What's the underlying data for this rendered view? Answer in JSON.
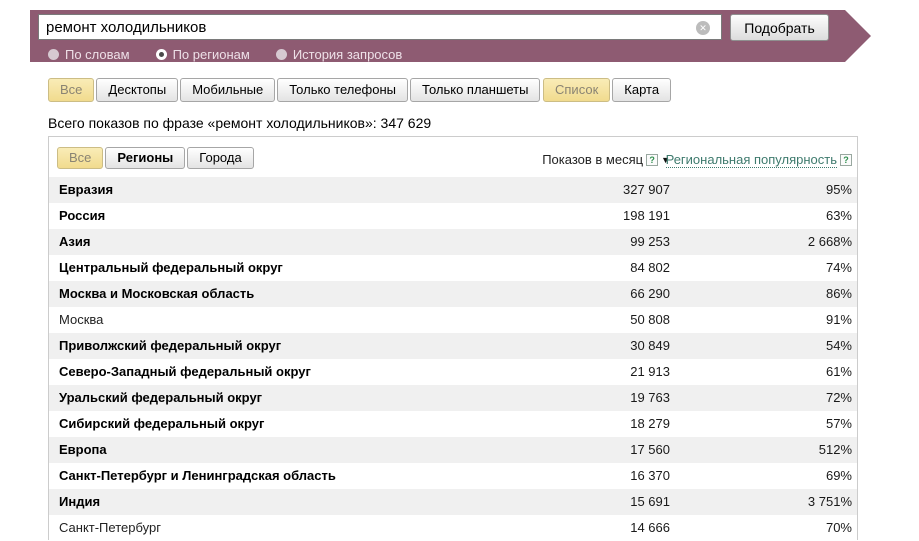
{
  "topbar": {
    "query": "ремонт холодильников",
    "submit": "Подобрать",
    "modes": [
      {
        "label": "По словам",
        "selected": false
      },
      {
        "label": "По регионам",
        "selected": true
      },
      {
        "label": "История запросов",
        "selected": false
      }
    ]
  },
  "filters": {
    "device_tabs": [
      {
        "label": "Все",
        "selected": true
      },
      {
        "label": "Десктопы",
        "selected": false
      },
      {
        "label": "Мобильные",
        "selected": false
      },
      {
        "label": "Только телефоны",
        "selected": false
      },
      {
        "label": "Только планшеты",
        "selected": false
      }
    ],
    "view_tabs": [
      {
        "label": "Список",
        "selected": true
      },
      {
        "label": "Карта",
        "selected": false
      }
    ]
  },
  "summary": {
    "text": "Всего показов по фразе «ремонт холодильников»: 347 629"
  },
  "table": {
    "tabs": [
      {
        "label": "Все",
        "selected": true
      },
      {
        "label": "Регионы",
        "selected": false
      },
      {
        "label": "Города",
        "selected": false
      }
    ],
    "columns": {
      "impressions": "Показов в месяц",
      "popularity": "Региональная популярность"
    },
    "rows": [
      {
        "name": "Евразия",
        "impressions": "327 907",
        "popularity": "95%"
      },
      {
        "name": "Россия",
        "impressions": "198 191",
        "popularity": "63%"
      },
      {
        "name": "Азия",
        "impressions": "99 253",
        "popularity": "2 668%"
      },
      {
        "name": "Центральный федеральный округ",
        "impressions": "84 802",
        "popularity": "74%"
      },
      {
        "name": "Москва и Московская область",
        "impressions": "66 290",
        "popularity": "86%"
      },
      {
        "name": "Москва",
        "impressions": "50 808",
        "popularity": "91%"
      },
      {
        "name": "Приволжский федеральный округ",
        "impressions": "30 849",
        "popularity": "54%"
      },
      {
        "name": "Северо-Западный федеральный округ",
        "impressions": "21 913",
        "popularity": "61%"
      },
      {
        "name": "Уральский федеральный округ",
        "impressions": "19 763",
        "popularity": "72%"
      },
      {
        "name": "Сибирский федеральный округ",
        "impressions": "18 279",
        "popularity": "57%"
      },
      {
        "name": "Европа",
        "impressions": "17 560",
        "popularity": "512%"
      },
      {
        "name": "Санкт-Петербург и Ленинградская область",
        "impressions": "16 370",
        "popularity": "69%"
      },
      {
        "name": "Индия",
        "impressions": "15 691",
        "popularity": "3 751%"
      },
      {
        "name": "Санкт-Петербург",
        "impressions": "14 666",
        "popularity": "70%"
      }
    ]
  },
  "icons": {
    "clear": "✕",
    "help": "?",
    "sort_desc": "▼"
  },
  "colors": {
    "bar": "#8e5b72",
    "tab_selected_bg": "#f5e3a0",
    "link": "#3e7a6d",
    "row_alt": "#f0f0f0"
  }
}
